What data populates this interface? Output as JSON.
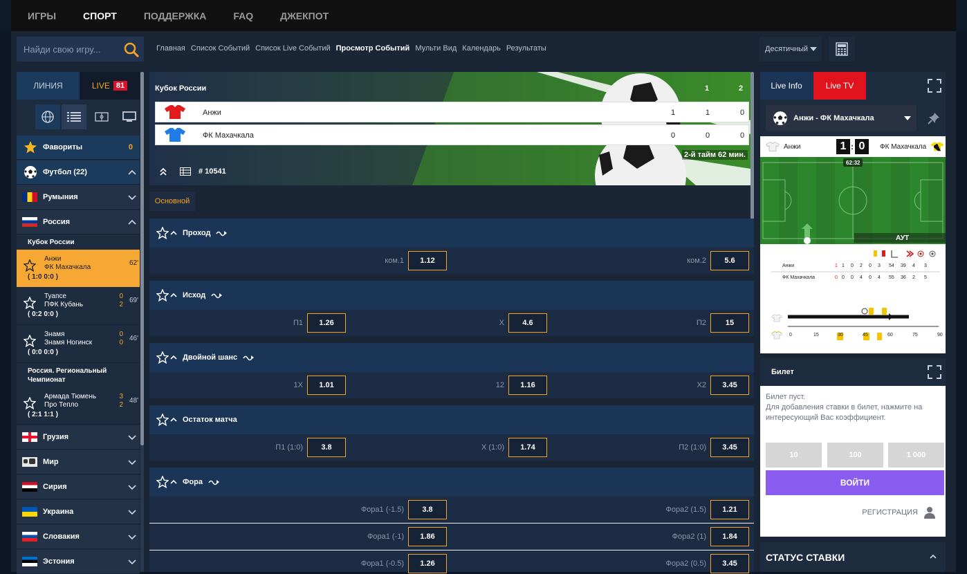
{
  "topnav": [
    "ИГРЫ",
    "СПОРТ",
    "ПОДДЕРЖКА",
    "FAQ",
    "ДЖЕКПОТ"
  ],
  "search": {
    "placeholder": "Найди свою игру..."
  },
  "breadcrumbs": [
    "Главная",
    "Список Событий",
    "Список Live Событий",
    "Просмотр Событий",
    "Мульти Вид",
    "Календарь",
    "Результаты"
  ],
  "odds_format": "Десятичный",
  "sidebar": {
    "tab_line": "ЛИНИЯ",
    "tab_live": "LIVE",
    "live_count": "81",
    "favorites": {
      "label": "Фавориты",
      "count": "0"
    },
    "football": "Футбол (22)",
    "romania": "Румыния",
    "russia": "Россия",
    "cup": "Кубок России",
    "matches": [
      {
        "team1": "Анжи",
        "team2": "ФК Махачкала",
        "score1": "",
        "score2": "",
        "minute": "62'",
        "result": "( 1:0   0:0 )"
      },
      {
        "team1": "Туапсе",
        "team2": "ПФК Кубань",
        "score1": "0",
        "score2": "2",
        "minute": "69'",
        "result": "( 0:2   0:0 )"
      },
      {
        "team1": "Знамя",
        "team2": "Знамя Ногинск",
        "score1": "0",
        "score2": "0",
        "minute": "46'",
        "result": "( 0:0   0:0 )"
      }
    ],
    "regional": "Россия. Региональный Чемпионат",
    "match4": {
      "team1": "Армада Тюмень",
      "team2": "Про Тепло",
      "score1": "3",
      "score2": "2",
      "minute": "48'",
      "result": "( 2:1   1:1 )"
    },
    "countries": [
      "Грузия",
      "Мир",
      "Сирия",
      "Украина",
      "Словакия",
      "Эстония"
    ]
  },
  "event": {
    "tournament": "Кубок России",
    "period_head": [
      "1",
      "2"
    ],
    "team1": {
      "name": "Анжи",
      "total": "1",
      "p1": "1",
      "p2": "0"
    },
    "team2": {
      "name": "ФК Махачкала",
      "total": "0",
      "p1": "0",
      "p2": "0"
    },
    "time": "2-й тайм  62 мин.",
    "id": "# 10541",
    "main_tab": "Основной"
  },
  "markets": [
    {
      "title": "Проход",
      "rows": [
        [
          {
            "l": "ком.1",
            "v": "1.12"
          },
          {
            "l": "ком.2",
            "v": "5.6"
          }
        ]
      ]
    },
    {
      "title": "Исход",
      "rows": [
        [
          {
            "l": "П1",
            "v": "1.26"
          },
          {
            "l": "Х",
            "v": "4.6"
          },
          {
            "l": "П2",
            "v": "15"
          }
        ]
      ]
    },
    {
      "title": "Двойной шанс",
      "rows": [
        [
          {
            "l": "1Х",
            "v": "1.01"
          },
          {
            "l": "12",
            "v": "1.16"
          },
          {
            "l": "Х2",
            "v": "3.45"
          }
        ]
      ]
    },
    {
      "title": "Остаток матча",
      "rows": [
        [
          {
            "l": "П1 (1:0)",
            "v": "3.8"
          },
          {
            "l": "Х (1:0)",
            "v": "1.74"
          },
          {
            "l": "П2 (1:0)",
            "v": "3.45"
          }
        ]
      ]
    },
    {
      "title": "Фора",
      "rows": [
        [
          {
            "l": "Фора1 (-1.5)",
            "v": "3.8"
          },
          {
            "l": "Фора2 (1.5)",
            "v": "1.21"
          }
        ],
        [
          {
            "l": "Фора1 (-1)",
            "v": "1.86"
          },
          {
            "l": "Фора2 (1)",
            "v": "1.84"
          }
        ],
        [
          {
            "l": "Фора1 (-0.5)",
            "v": "1.26"
          },
          {
            "l": "Фора2 (0.5)",
            "v": "3.45"
          }
        ]
      ]
    }
  ],
  "live": {
    "tab_info": "Live Info",
    "tab_tv": "Live TV",
    "match": "Анжи - ФК Махачкала",
    "home": "Анжи",
    "away": "ФК Махачкала",
    "home_score": "1",
    "away_score": "0",
    "clock": "62:32",
    "event_label": "АУТ",
    "stats_home": [
      "1",
      "1",
      "0",
      "2",
      "0",
      "3",
      "54",
      "39",
      "4",
      "3"
    ],
    "stats_away": [
      "0",
      "0",
      "0",
      "4",
      "0",
      "4",
      "55",
      "36",
      "2",
      "5"
    ],
    "timeline": [
      "0",
      "15",
      "30",
      "45",
      "60",
      "75",
      "90"
    ]
  },
  "ticket": {
    "title": "Билет",
    "empty": "Билет пуст.",
    "hint": "Для добавления ставки в билет, нажмите на интересующий Вас коэффициент.",
    "quick": [
      "10",
      "100",
      "1 000"
    ],
    "login": "ВОЙТИ",
    "register": "РЕГИСТРАЦИЯ"
  },
  "bet_status": "СТАТУС СТАВКИ"
}
